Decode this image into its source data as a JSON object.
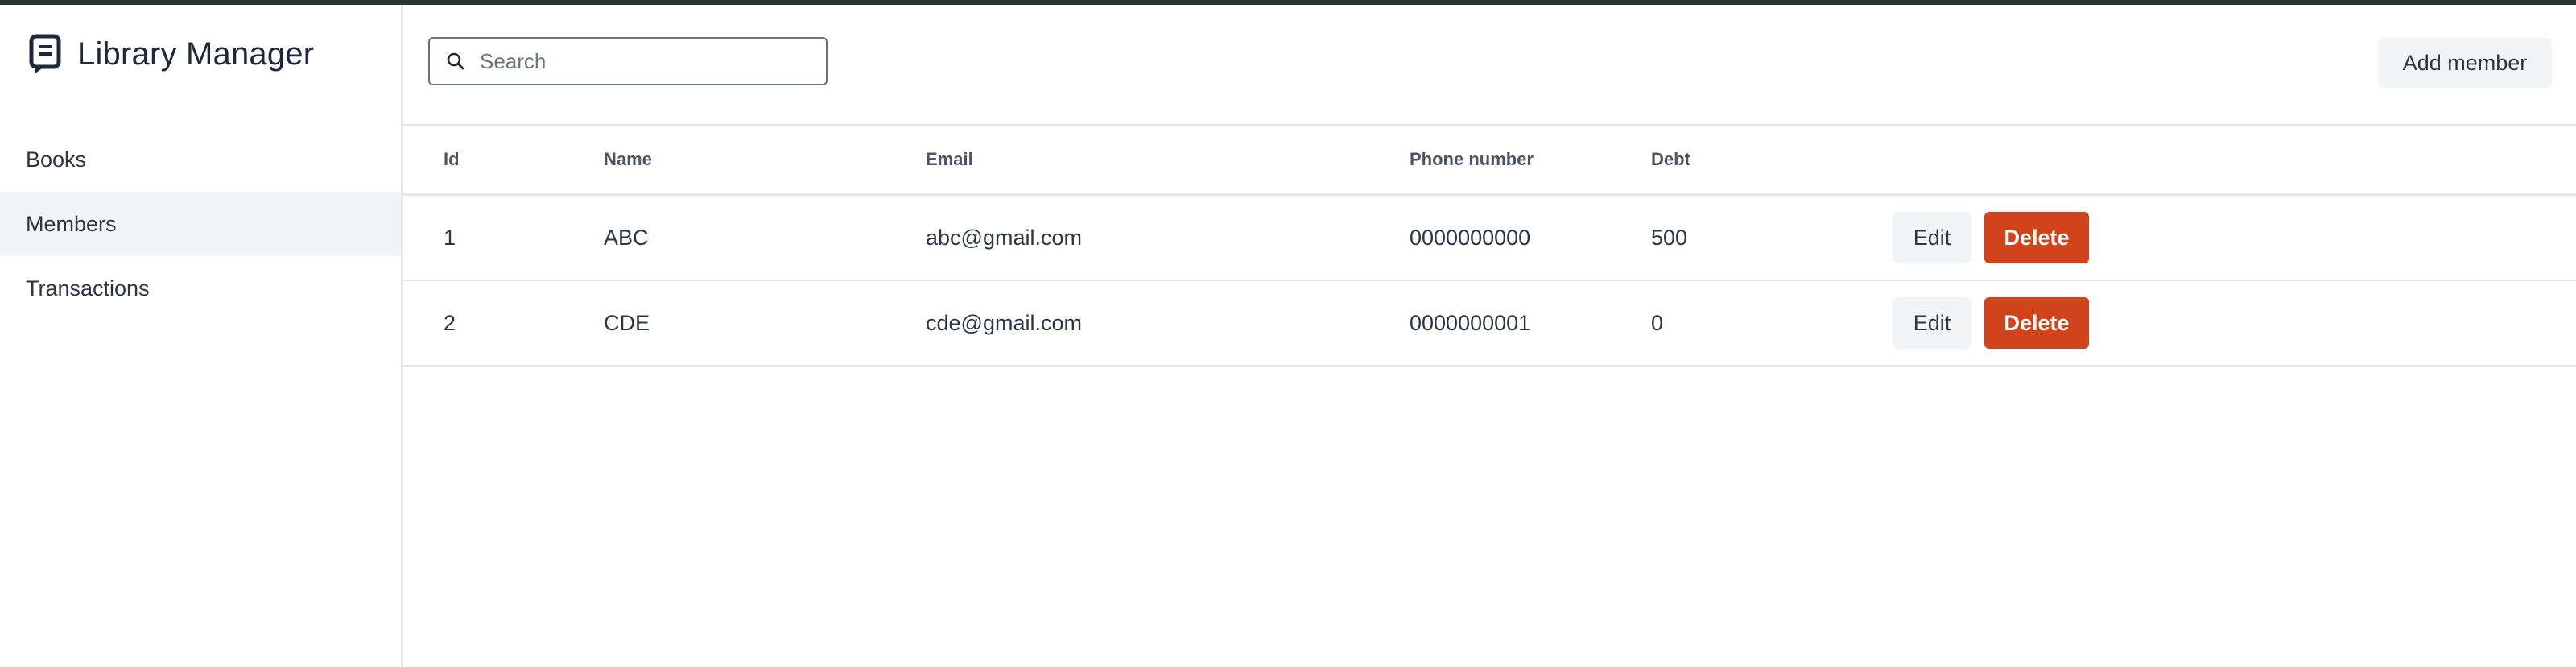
{
  "app": {
    "title": "Library Manager",
    "logo_icon": "book-bookmark-icon"
  },
  "sidebar": {
    "items": [
      {
        "label": "Books",
        "active": false
      },
      {
        "label": "Members",
        "active": true
      },
      {
        "label": "Transactions",
        "active": false
      }
    ]
  },
  "toolbar": {
    "search_placeholder": "Search",
    "search_value": "",
    "search_icon": "search-icon",
    "add_label": "Add member"
  },
  "table": {
    "columns": [
      "Id",
      "Name",
      "Email",
      "Phone number",
      "Debt"
    ],
    "rows": [
      {
        "id": "1",
        "name": "ABC",
        "email": "abc@gmail.com",
        "phone": "0000000000",
        "debt": "500",
        "edit_label": "Edit",
        "delete_label": "Delete"
      },
      {
        "id": "2",
        "name": "CDE",
        "email": "cde@gmail.com",
        "phone": "0000000001",
        "debt": "0",
        "edit_label": "Edit",
        "delete_label": "Delete"
      }
    ]
  },
  "colors": {
    "topbar": "#2d3532",
    "delete": "#d1431b",
    "neutral_button": "#f3f4f6",
    "active_nav": "#f3f4f6"
  }
}
